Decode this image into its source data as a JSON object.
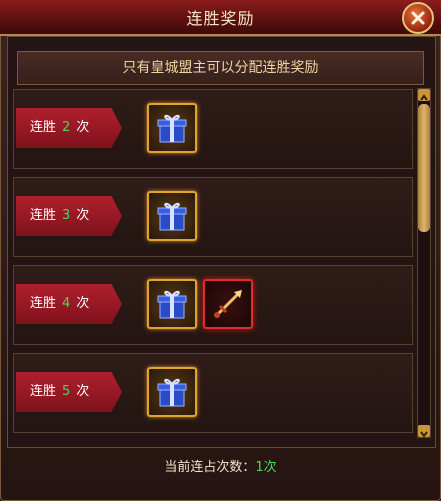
{
  "window": {
    "title": "连胜奖励"
  },
  "notice": "只有皇城盟主可以分配连胜奖励",
  "rows": [
    {
      "prefix": "连胜",
      "count": "2",
      "suffix": "次",
      "rewards": [
        "gift-box-icon"
      ]
    },
    {
      "prefix": "连胜",
      "count": "3",
      "suffix": "次",
      "rewards": [
        "gift-box-icon"
      ]
    },
    {
      "prefix": "连胜",
      "count": "4",
      "suffix": "次",
      "rewards": [
        "gift-box-icon",
        "weapon-icon"
      ]
    },
    {
      "prefix": "连胜",
      "count": "5",
      "suffix": "次",
      "rewards": [
        "gift-box-icon"
      ]
    }
  ],
  "footer": {
    "label": "当前连占次数：",
    "value": "1次"
  },
  "colors": {
    "accent_green": "#4dd65a",
    "title_red": "#8b1d1d",
    "gold": "#e0a430"
  }
}
